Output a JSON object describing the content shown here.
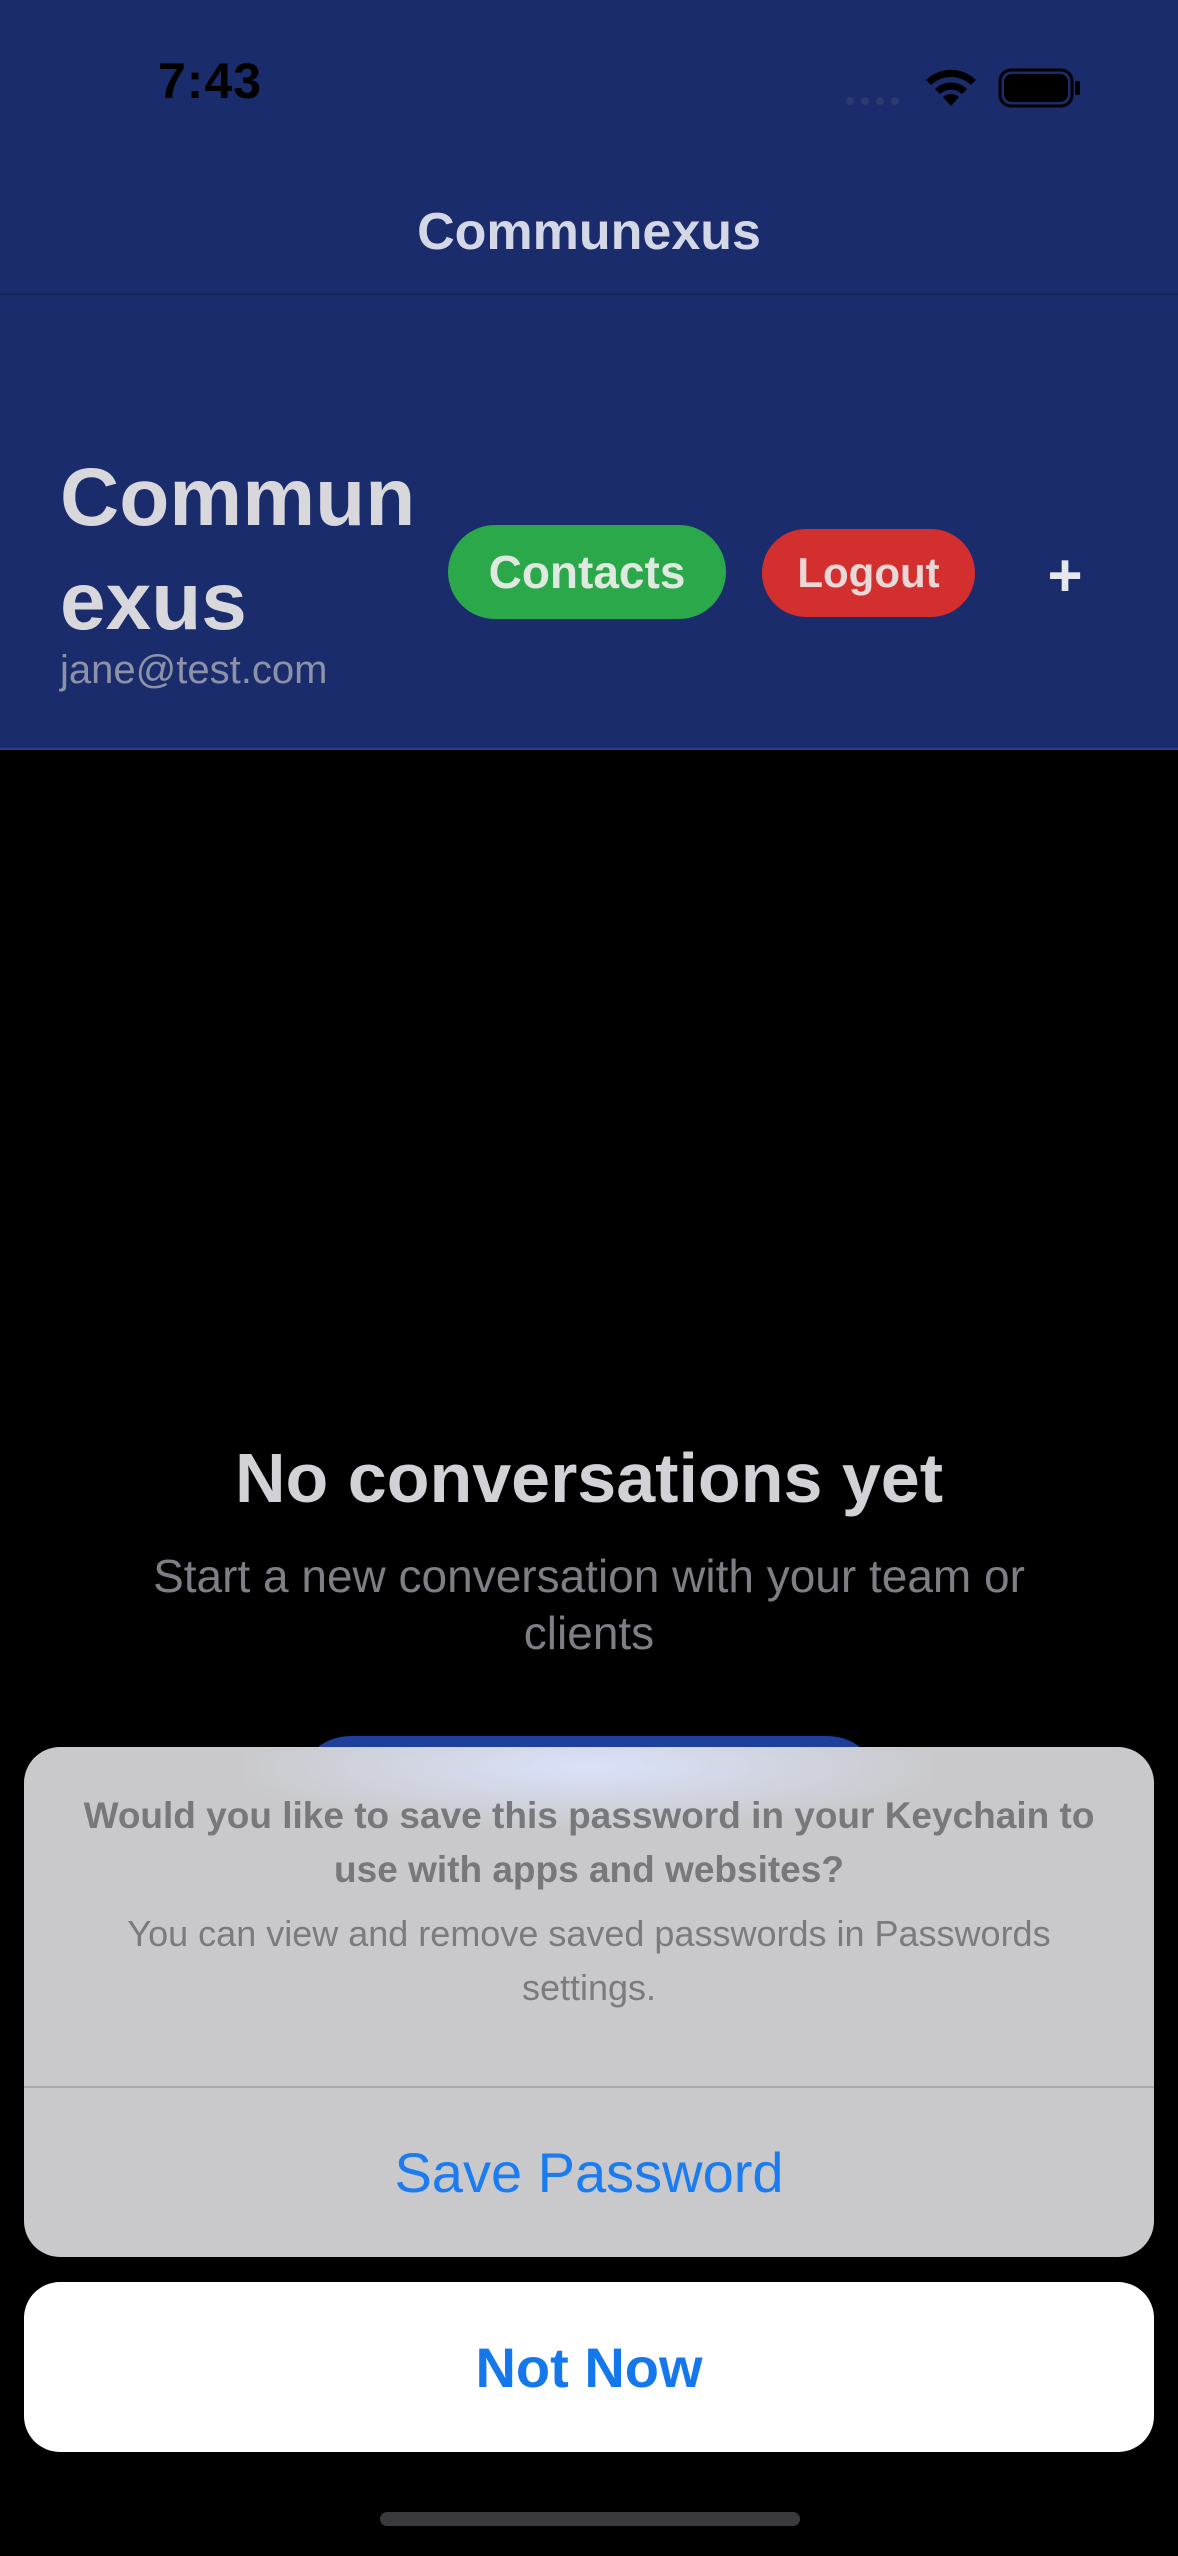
{
  "status_bar": {
    "time": "7:43",
    "wifi_icon": "wifi-icon",
    "battery_icon": "battery-icon"
  },
  "nav": {
    "title": "Communexus"
  },
  "header": {
    "brand_title": "Commun exus",
    "email": "jane@test.com",
    "contacts_label": "Contacts",
    "logout_label": "Logout",
    "add_label": "+"
  },
  "empty_state": {
    "title": "No conversations yet",
    "subtitle": "Start a new conversation with your team or clients"
  },
  "action_sheet": {
    "title": "Would you like to save this password in your Keychain to use with apps and websites?",
    "message": "You can view and remove saved passwords in Passwords settings.",
    "save_label": "Save Password",
    "cancel_label": "Not Now"
  },
  "colors": {
    "header_bg": "#1b2c6c",
    "contacts_green": "#2ba84a",
    "logout_red": "#d42f2f",
    "ios_blue": "#1a7cf0"
  }
}
